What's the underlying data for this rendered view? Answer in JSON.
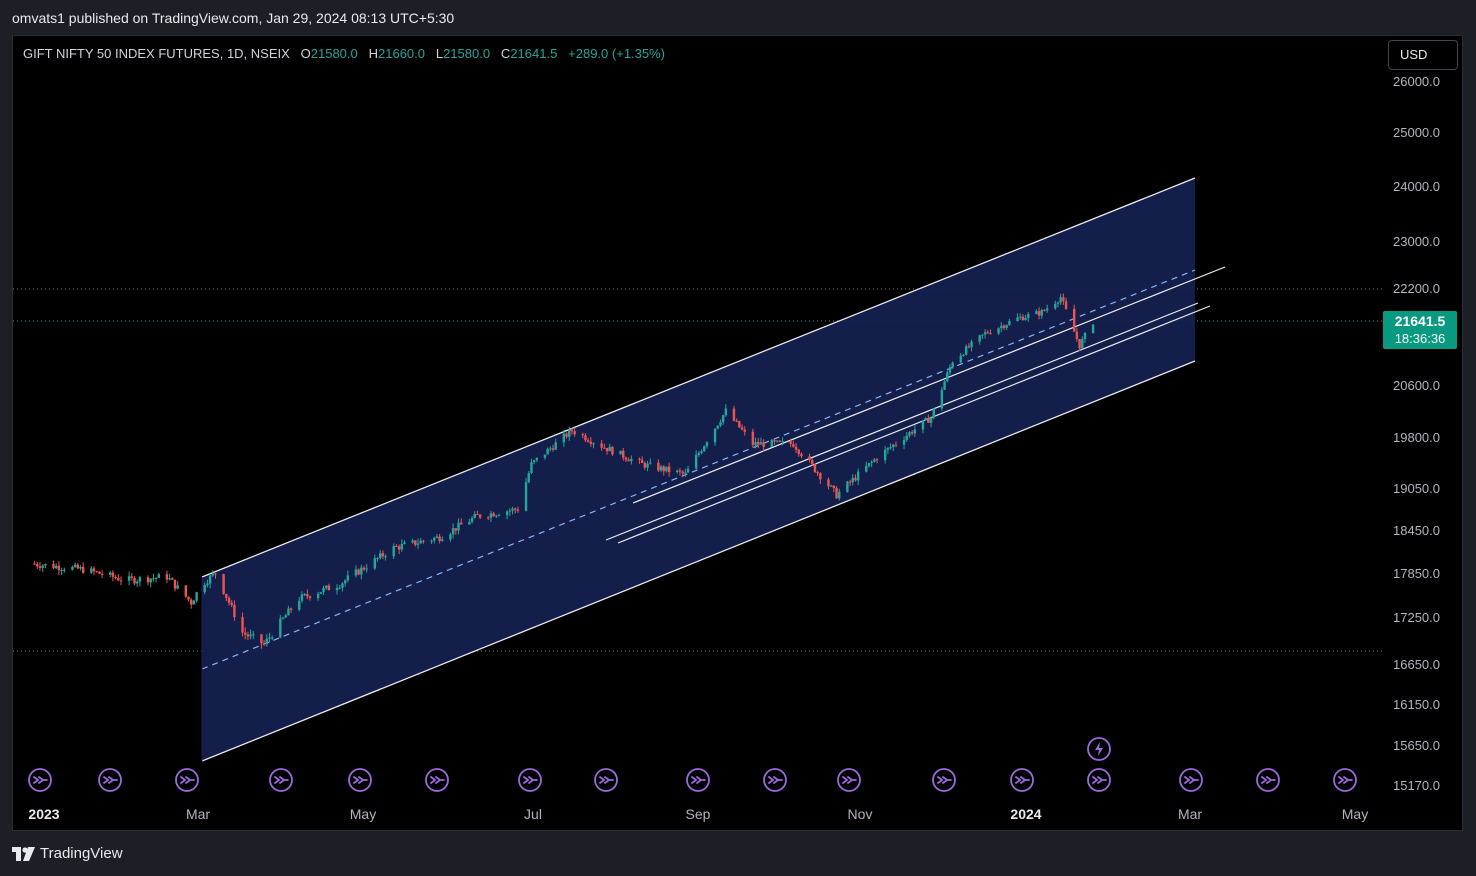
{
  "header": {
    "published_text": "omvats1 published on TradingView.com, Jan 29, 2024 08:13 UTC+5:30"
  },
  "symbol": {
    "name": "GIFT NIFTY 50 INDEX FUTURES, 1D, NSEIX",
    "open_label": "O",
    "open": "21580.0",
    "high_label": "H",
    "high": "21660.0",
    "low_label": "L",
    "low": "21580.0",
    "close_label": "C",
    "close": "21641.5",
    "change": "+289.0 (+1.35%)"
  },
  "currency": "USD",
  "price_axis": {
    "ticks": [
      "26000.0",
      "25000.0",
      "24000.0",
      "23000.0",
      "22200.0",
      "20600.0",
      "19800.0",
      "19050.0",
      "18450.0",
      "17850.0",
      "17250.0",
      "16650.0",
      "16150.0",
      "15650.0",
      "15170.0"
    ]
  },
  "last_price": {
    "value": "21641.5",
    "countdown": "18:36:36"
  },
  "time_axis": {
    "ticks": [
      "2023",
      "Mar",
      "May",
      "Jul",
      "Sep",
      "Nov",
      "2024",
      "Mar",
      "May"
    ]
  },
  "footer": {
    "brand": "TradingView"
  },
  "colors": {
    "up": "#26a69a",
    "down": "#ef5350",
    "channel_fill": "#162150",
    "event_icon": "#9c6ade",
    "badge": "#089981"
  },
  "icons": {
    "events": "dividend-event-icon",
    "earnings": "lightning-icon",
    "logo": "tradingview-logo-icon"
  },
  "chart_data": {
    "type": "candlestick",
    "series_path": [
      [
        "2023-01-01",
        17980
      ],
      [
        "2023-01-20",
        17900
      ],
      [
        "2023-02-05",
        17750
      ],
      [
        "2023-02-20",
        17800
      ],
      [
        "2023-03-01",
        17450
      ],
      [
        "2023-03-05",
        17700
      ],
      [
        "2023-03-10",
        17850
      ],
      [
        "2023-03-20",
        17050
      ],
      [
        "2023-03-28",
        16900
      ],
      [
        "2023-04-10",
        17500
      ],
      [
        "2023-04-25",
        17700
      ],
      [
        "2023-05-15",
        18200
      ],
      [
        "2023-06-01",
        18350
      ],
      [
        "2023-06-15",
        18650
      ],
      [
        "2023-06-30",
        18750
      ],
      [
        "2023-07-05",
        19400
      ],
      [
        "2023-07-20",
        19900
      ],
      [
        "2023-08-01",
        19650
      ],
      [
        "2023-08-15",
        19400
      ],
      [
        "2023-08-31",
        19250
      ],
      [
        "2023-09-15",
        20200
      ],
      [
        "2023-09-25",
        19700
      ],
      [
        "2023-10-10",
        19700
      ],
      [
        "2023-10-26",
        18950
      ],
      [
        "2023-11-10",
        19500
      ],
      [
        "2023-11-30",
        20100
      ],
      [
        "2023-12-08",
        21000
      ],
      [
        "2023-12-20",
        21450
      ],
      [
        "2024-01-01",
        21700
      ],
      [
        "2024-01-10",
        21800
      ],
      [
        "2024-01-17",
        22050
      ],
      [
        "2024-01-24",
        21250
      ],
      [
        "2024-01-29",
        21641.5
      ]
    ],
    "last_close": 21641.5,
    "ylim": [
      15170,
      26000
    ],
    "xlim": [
      "2022-12-25",
      "2024-05-15"
    ],
    "horizontal_levels": [
      22200,
      21641.5,
      16650
    ],
    "drawings": [
      "regression-channel",
      "parallel-lines"
    ]
  }
}
